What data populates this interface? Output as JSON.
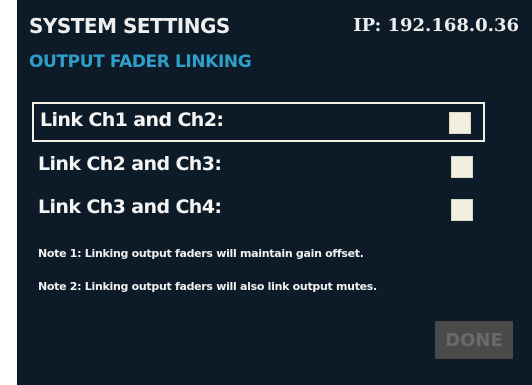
{
  "header": {
    "title": "SYSTEM SETTINGS",
    "ip": "IP: 192.168.0.36",
    "subtitle": "OUTPUT FADER LINKING"
  },
  "links": [
    {
      "label": "Link Ch1 and Ch2:",
      "checked": false,
      "selected": true
    },
    {
      "label": "Link Ch2 and Ch3:",
      "checked": false,
      "selected": false
    },
    {
      "label": "Link Ch3 and Ch4:",
      "checked": false,
      "selected": false
    }
  ],
  "notes": [
    "Note 1: Linking output faders will maintain gain offset.",
    "Note 2: Linking output faders will also link output mutes."
  ],
  "actions": {
    "done_label": "DONE",
    "done_enabled": false
  },
  "colors": {
    "background": "#0c1b27",
    "accent": "#2f9ec9",
    "text": "#f4f4f4",
    "checkbox": "#f1efdf",
    "disabled_button": "#4a4a4a"
  }
}
